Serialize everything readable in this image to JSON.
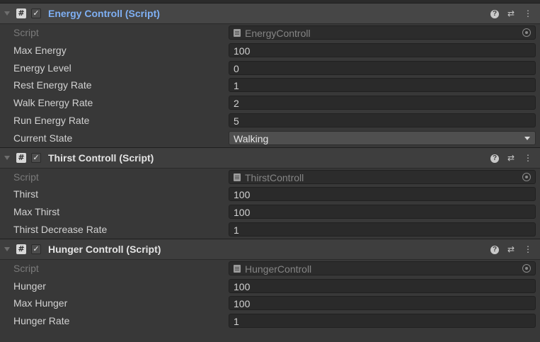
{
  "components": [
    {
      "title": "Energy Controll (Script)",
      "script_label": "Script",
      "script_value": "EnergyControll",
      "fields": [
        {
          "label": "Max Energy",
          "value": "100"
        },
        {
          "label": "Energy Level",
          "value": "0"
        },
        {
          "label": "Rest Energy Rate",
          "value": "1"
        },
        {
          "label": "Walk Energy Rate",
          "value": "2"
        },
        {
          "label": "Run Energy Rate",
          "value": "5"
        }
      ],
      "dropdown": {
        "label": "Current State",
        "value": "Walking"
      }
    },
    {
      "title": "Thirst Controll (Script)",
      "script_label": "Script",
      "script_value": "ThirstControll",
      "fields": [
        {
          "label": "Thirst",
          "value": "100"
        },
        {
          "label": "Max Thirst",
          "value": "100"
        },
        {
          "label": "Thirst Decrease Rate",
          "value": "1"
        }
      ]
    },
    {
      "title": "Hunger Controll (Script)",
      "script_label": "Script",
      "script_value": "HungerControll",
      "fields": [
        {
          "label": "Hunger",
          "value": "100"
        },
        {
          "label": "Max Hunger",
          "value": "100"
        },
        {
          "label": "Hunger Rate",
          "value": "1"
        }
      ]
    }
  ],
  "icons": {
    "script_icon": "#",
    "checkbox": "✓",
    "help": "?",
    "presets": "⇄",
    "menu": "⋮"
  },
  "colors": {
    "selected_title": "#7fb0f4",
    "panel_bg": "#383838"
  }
}
